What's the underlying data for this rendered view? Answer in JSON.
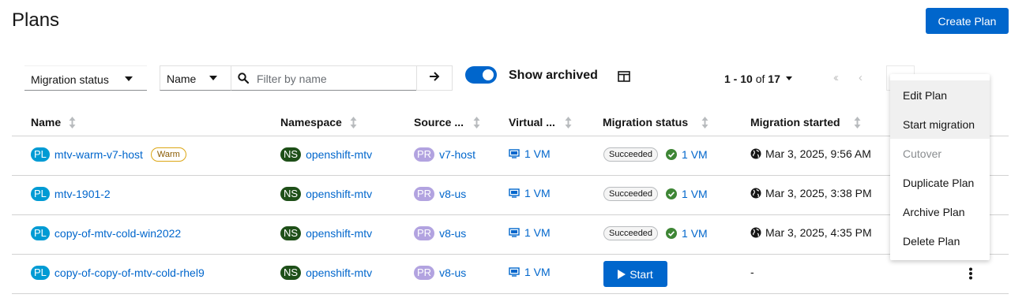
{
  "page": {
    "title": "Plans",
    "create_label": "Create Plan"
  },
  "toolbar": {
    "status_filter_label": "Migration status",
    "name_select_label": "Name",
    "search_placeholder": "Filter by name",
    "show_archived_label": "Show archived",
    "show_archived_on": true,
    "pagination_range": "1 - 10",
    "pagination_of": "of",
    "pagination_total": "17"
  },
  "table": {
    "headers": [
      "Name",
      "Namespace",
      "Source ...",
      "Virtual ...",
      "Migration status",
      "Migration started"
    ],
    "rows": [
      {
        "name_badge": "PL",
        "name": "mtv-warm-v7-host",
        "tag": "Warm",
        "ns_badge": "NS",
        "namespace": "openshift-mtv",
        "src_badge": "PR",
        "source": "v7-host",
        "vms": "1 VM",
        "status": "Succeeded",
        "status_vms": "1 VM",
        "started": "Mar 3, 2025, 9:56 AM"
      },
      {
        "name_badge": "PL",
        "name": "mtv-1901-2",
        "tag": "",
        "ns_badge": "NS",
        "namespace": "openshift-mtv",
        "src_badge": "PR",
        "source": "v8-us",
        "vms": "1 VM",
        "status": "Succeeded",
        "status_vms": "1 VM",
        "started": "Mar 3, 2025, 3:38 PM"
      },
      {
        "name_badge": "PL",
        "name": "copy-of-mtv-cold-win2022",
        "tag": "",
        "ns_badge": "NS",
        "namespace": "openshift-mtv",
        "src_badge": "PR",
        "source": "v8-us",
        "vms": "1 VM",
        "status": "Succeeded",
        "status_vms": "1 VM",
        "started": "Mar 3, 2025, 4:35 PM"
      },
      {
        "name_badge": "PL",
        "name": "copy-of-copy-of-mtv-cold-rhel9",
        "tag": "",
        "ns_badge": "NS",
        "namespace": "openshift-mtv",
        "src_badge": "PR",
        "source": "v8-us",
        "vms": "1 VM",
        "start_label": "Start",
        "started": "-"
      }
    ]
  },
  "menu": {
    "items": [
      "Edit Plan",
      "Start migration",
      "Cutover",
      "Duplicate Plan",
      "Archive Plan",
      "Delete Plan"
    ]
  }
}
